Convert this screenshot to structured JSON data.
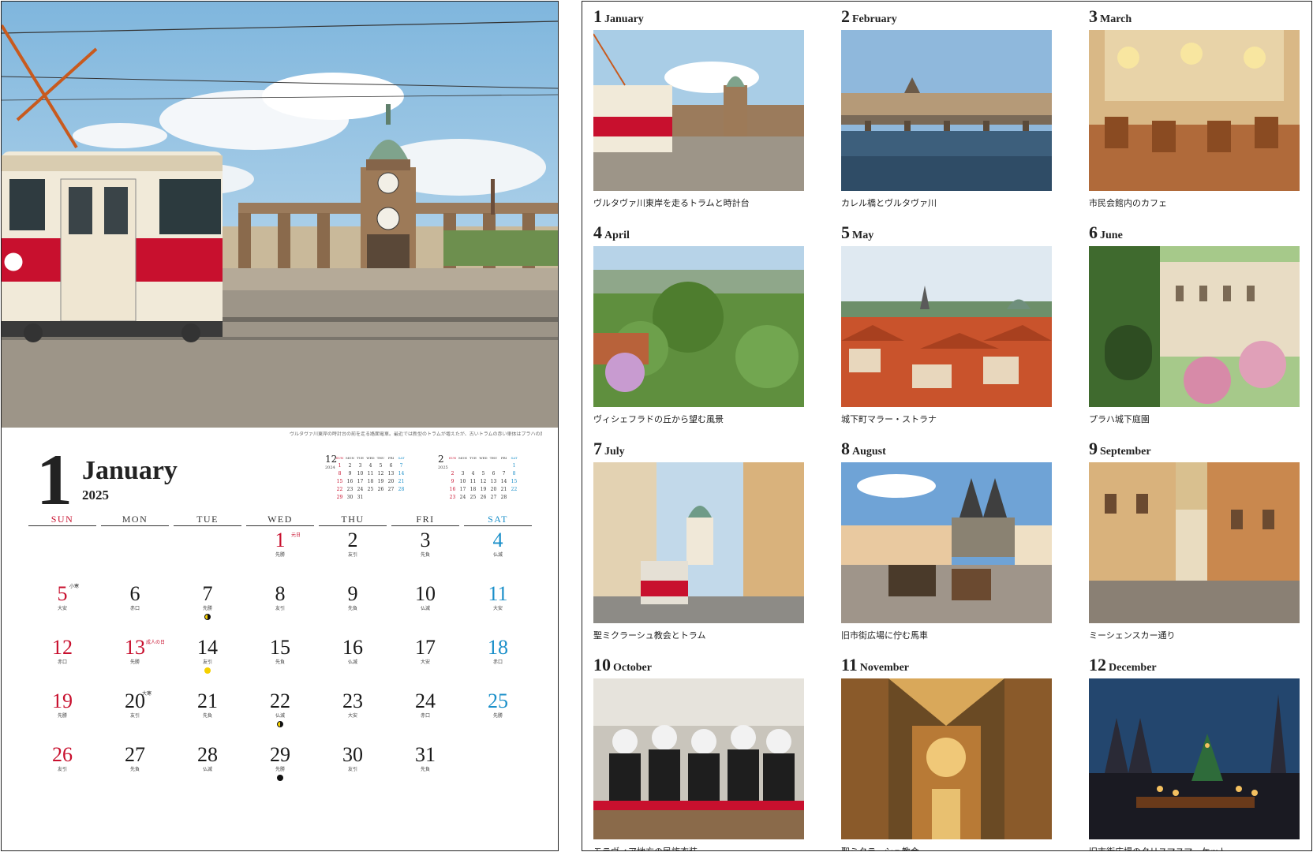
{
  "left": {
    "month_number": "1",
    "month_name": "January",
    "year": "2025",
    "photo_caption": "ヴルタヴァ川東岸の時計台の前を走る路面電車。最近では新型のトラムが増えたが、古いトラムの赤い車体はプラハの風景に欠かせない。",
    "weekday_headers": [
      "SUN",
      "MON",
      "TUE",
      "WED",
      "THU",
      "FRI",
      "SAT"
    ],
    "mini_prev": {
      "month": "12",
      "year": "2024",
      "headers": [
        "SUN",
        "MON",
        "TUE",
        "WED",
        "THU",
        "FRI",
        "SAT"
      ],
      "weeks": [
        [
          "1",
          "2",
          "3",
          "4",
          "5",
          "6",
          "7"
        ],
        [
          "8",
          "9",
          "10",
          "11",
          "12",
          "13",
          "14"
        ],
        [
          "15",
          "16",
          "17",
          "18",
          "19",
          "20",
          "21"
        ],
        [
          "22",
          "23",
          "24",
          "25",
          "26",
          "27",
          "28"
        ],
        [
          "29",
          "30",
          "31",
          "",
          "",
          "",
          ""
        ]
      ]
    },
    "mini_next": {
      "month": "2",
      "year": "2025",
      "headers": [
        "SUN",
        "MON",
        "TUE",
        "WED",
        "THU",
        "FRI",
        "SAT"
      ],
      "weeks": [
        [
          "",
          "",
          "",
          "",
          "",
          "",
          "1"
        ],
        [
          "2",
          "3",
          "4",
          "5",
          "6",
          "7",
          "8"
        ],
        [
          "9",
          "10",
          "11",
          "12",
          "13",
          "14",
          "15"
        ],
        [
          "16",
          "17",
          "18",
          "19",
          "20",
          "21",
          "22"
        ],
        [
          "23",
          "24",
          "25",
          "26",
          "27",
          "28",
          ""
        ]
      ]
    },
    "days": [
      {
        "date": "1",
        "rokuyo": "先勝",
        "holiday": "元日",
        "col": 3,
        "row": 0,
        "color": "red"
      },
      {
        "date": "2",
        "rokuyo": "友引",
        "col": 4,
        "row": 0
      },
      {
        "date": "3",
        "rokuyo": "先負",
        "col": 5,
        "row": 0
      },
      {
        "date": "4",
        "rokuyo": "仏滅",
        "col": 6,
        "row": 0,
        "color": "blue"
      },
      {
        "date": "5",
        "rokuyo": "大安",
        "season": "小寒",
        "col": 0,
        "row": 1,
        "color": "red"
      },
      {
        "date": "6",
        "rokuyo": "赤口",
        "col": 1,
        "row": 1
      },
      {
        "date": "7",
        "rokuyo": "先勝",
        "moon": "half",
        "col": 2,
        "row": 1
      },
      {
        "date": "8",
        "rokuyo": "友引",
        "col": 3,
        "row": 1
      },
      {
        "date": "9",
        "rokuyo": "先負",
        "col": 4,
        "row": 1
      },
      {
        "date": "10",
        "rokuyo": "仏滅",
        "col": 5,
        "row": 1
      },
      {
        "date": "11",
        "rokuyo": "大安",
        "col": 6,
        "row": 1,
        "color": "blue"
      },
      {
        "date": "12",
        "rokuyo": "赤口",
        "col": 0,
        "row": 2,
        "color": "red"
      },
      {
        "date": "13",
        "rokuyo": "先勝",
        "holiday": "成人の日",
        "col": 1,
        "row": 2,
        "color": "red"
      },
      {
        "date": "14",
        "rokuyo": "友引",
        "moon": "full",
        "col": 2,
        "row": 2
      },
      {
        "date": "15",
        "rokuyo": "先負",
        "col": 3,
        "row": 2
      },
      {
        "date": "16",
        "rokuyo": "仏滅",
        "col": 4,
        "row": 2
      },
      {
        "date": "17",
        "rokuyo": "大安",
        "col": 5,
        "row": 2
      },
      {
        "date": "18",
        "rokuyo": "赤口",
        "col": 6,
        "row": 2,
        "color": "blue"
      },
      {
        "date": "19",
        "rokuyo": "先勝",
        "col": 0,
        "row": 3,
        "color": "red"
      },
      {
        "date": "20",
        "rokuyo": "友引",
        "season": "大寒",
        "col": 1,
        "row": 3
      },
      {
        "date": "21",
        "rokuyo": "先負",
        "col": 2,
        "row": 3
      },
      {
        "date": "22",
        "rokuyo": "仏滅",
        "moon": "half",
        "col": 3,
        "row": 3
      },
      {
        "date": "23",
        "rokuyo": "大安",
        "col": 4,
        "row": 3
      },
      {
        "date": "24",
        "rokuyo": "赤口",
        "col": 5,
        "row": 3
      },
      {
        "date": "25",
        "rokuyo": "先勝",
        "col": 6,
        "row": 3,
        "color": "blue"
      },
      {
        "date": "26",
        "rokuyo": "友引",
        "col": 0,
        "row": 4,
        "color": "red"
      },
      {
        "date": "27",
        "rokuyo": "先負",
        "col": 1,
        "row": 4
      },
      {
        "date": "28",
        "rokuyo": "仏滅",
        "col": 2,
        "row": 4
      },
      {
        "date": "29",
        "rokuyo": "先勝",
        "moon": "new",
        "col": 3,
        "row": 4
      },
      {
        "date": "30",
        "rokuyo": "友引",
        "col": 4,
        "row": 4
      },
      {
        "date": "31",
        "rokuyo": "先負",
        "col": 5,
        "row": 4
      }
    ]
  },
  "colors": {
    "sunday": "#c8102e",
    "saturday": "#1a8fc9",
    "text": "#1a1a1a",
    "full_moon": "#f5d000"
  },
  "right": {
    "months": [
      {
        "num": "1",
        "name": "January",
        "caption": "ヴルタヴァ川東岸を走るトラムと時計台",
        "scene": "tram"
      },
      {
        "num": "2",
        "name": "February",
        "caption": "カレル橋とヴルタヴァ川",
        "scene": "bridge"
      },
      {
        "num": "3",
        "name": "March",
        "caption": "市民会館内のカフェ",
        "scene": "cafe"
      },
      {
        "num": "4",
        "name": "April",
        "caption": "ヴィシェフラドの丘から望む風景",
        "scene": "garden"
      },
      {
        "num": "5",
        "name": "May",
        "caption": "城下町マラー・ストラナ",
        "scene": "roofs"
      },
      {
        "num": "6",
        "name": "June",
        "caption": "プラハ城下庭園",
        "scene": "palace-garden"
      },
      {
        "num": "7",
        "name": "July",
        "caption": "聖ミクラーシュ教会とトラム",
        "scene": "street-tram"
      },
      {
        "num": "8",
        "name": "August",
        "caption": "旧市街広場に佇む馬車",
        "scene": "square"
      },
      {
        "num": "9",
        "name": "September",
        "caption": "ミーシェンスカー通り",
        "scene": "lane"
      },
      {
        "num": "10",
        "name": "October",
        "caption": "モラヴィア地方の民族衣装",
        "scene": "costume"
      },
      {
        "num": "11",
        "name": "November",
        "caption": "聖ミクラーシュ教会",
        "scene": "church-interior"
      },
      {
        "num": "12",
        "name": "December",
        "caption": "旧市街広場のクリスマスマーケット",
        "scene": "night-market"
      }
    ]
  }
}
